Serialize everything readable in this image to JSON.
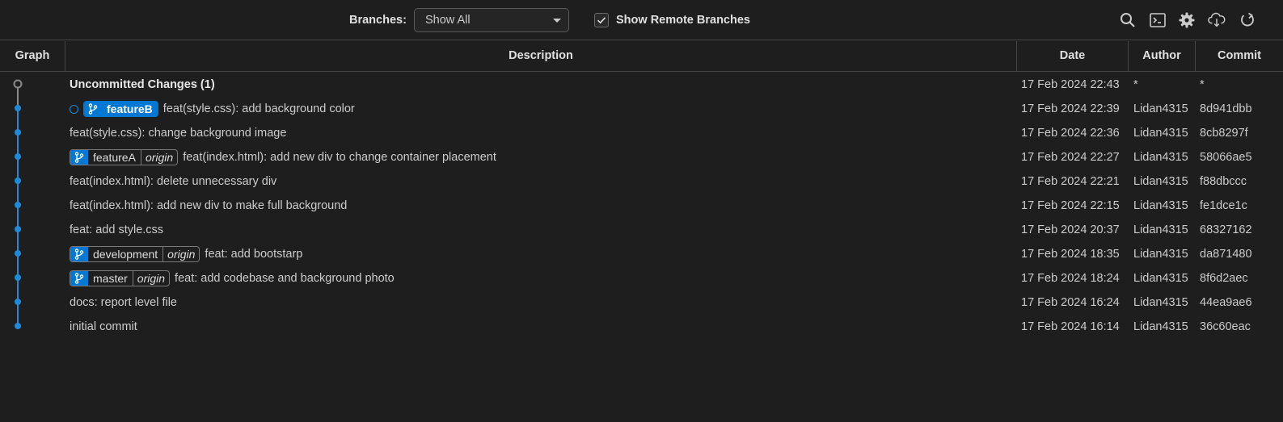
{
  "toolbar": {
    "branches_label": "Branches:",
    "branch_select": "Show All",
    "show_remote_label": "Show Remote Branches",
    "show_remote_checked": true,
    "icons": [
      "search-icon",
      "terminal-icon",
      "settings-gear-icon",
      "cloud-fetch-icon",
      "refresh-icon"
    ]
  },
  "columns": {
    "graph": "Graph",
    "description": "Description",
    "date": "Date",
    "author": "Author",
    "commit": "Commit"
  },
  "colors": {
    "accent": "#0078d4",
    "graph_line": "#1f8ad8",
    "uncommitted_node": "#8a8a8a",
    "background": "#1e1e1e"
  },
  "uncommitted": {
    "label": "Uncommitted Changes (1)",
    "date": "17 Feb 2024 22:43",
    "author": "*",
    "commit": "*"
  },
  "commits": [
    {
      "refs": [
        {
          "name": "featureB",
          "origin": null,
          "active": true
        }
      ],
      "message": "feat(style.css): add background color",
      "date": "17 Feb 2024 22:39",
      "author": "Lidan4315",
      "hash": "8d941dbb"
    },
    {
      "refs": [],
      "message": "feat(style.css): change background image",
      "date": "17 Feb 2024 22:36",
      "author": "Lidan4315",
      "hash": "8cb8297f"
    },
    {
      "refs": [
        {
          "name": "featureA",
          "origin": "origin",
          "active": false
        }
      ],
      "message": "feat(index.html): add new div to change container placement",
      "date": "17 Feb 2024 22:27",
      "author": "Lidan4315",
      "hash": "58066ae5"
    },
    {
      "refs": [],
      "message": "feat(index.html): delete unnecessary div",
      "date": "17 Feb 2024 22:21",
      "author": "Lidan4315",
      "hash": "f88dbccc"
    },
    {
      "refs": [],
      "message": "feat(index.html): add new div to make full background",
      "date": "17 Feb 2024 22:15",
      "author": "Lidan4315",
      "hash": "fe1dce1c"
    },
    {
      "refs": [],
      "message": "feat: add style.css",
      "date": "17 Feb 2024 20:37",
      "author": "Lidan4315",
      "hash": "68327162"
    },
    {
      "refs": [
        {
          "name": "development",
          "origin": "origin",
          "active": false
        }
      ],
      "message": "feat: add bootstarp",
      "date": "17 Feb 2024 18:35",
      "author": "Lidan4315",
      "hash": "da871480"
    },
    {
      "refs": [
        {
          "name": "master",
          "origin": "origin",
          "active": false
        }
      ],
      "message": "feat: add codebase and background photo",
      "date": "17 Feb 2024 18:24",
      "author": "Lidan4315",
      "hash": "8f6d2aec"
    },
    {
      "refs": [],
      "message": "docs: report level file",
      "date": "17 Feb 2024 16:24",
      "author": "Lidan4315",
      "hash": "44ea9ae6"
    },
    {
      "refs": [],
      "message": "initial commit",
      "date": "17 Feb 2024 16:14",
      "author": "Lidan4315",
      "hash": "36c60eac"
    }
  ]
}
